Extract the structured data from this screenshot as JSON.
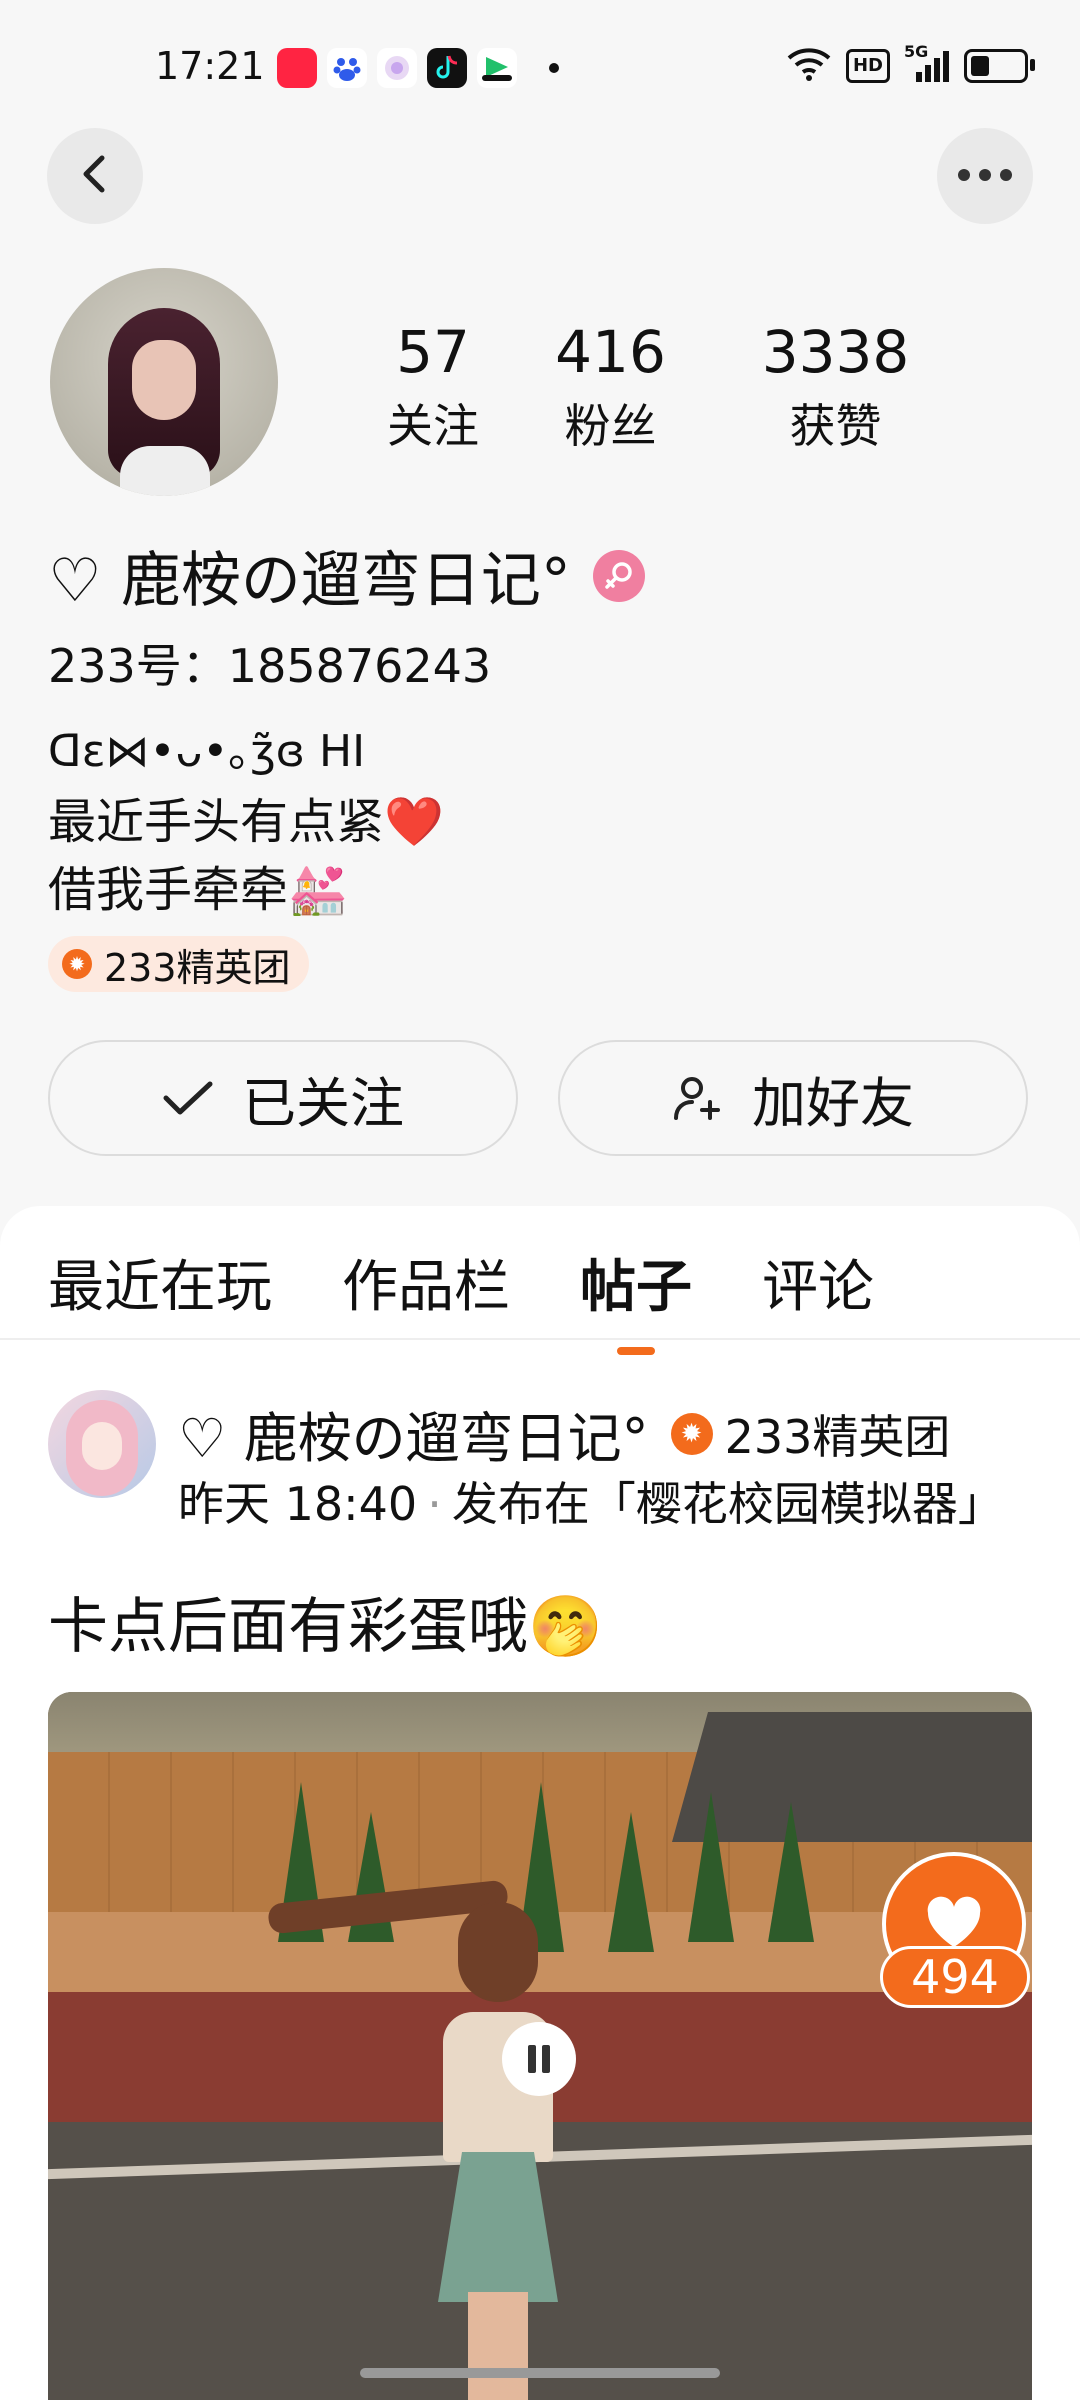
{
  "status_bar": {
    "time": "17:21",
    "app_icons": [
      "xiaohongshu-icon",
      "baidu-icon",
      "app-icon",
      "tiktok-icon",
      "video-app-icon"
    ],
    "hd_label": "HD",
    "network_label": "5G",
    "battery_level": 0.35
  },
  "profile": {
    "stats": [
      {
        "value": "57",
        "label": "关注"
      },
      {
        "value": "416",
        "label": "粉丝"
      },
      {
        "value": "3338",
        "label": "获赞"
      }
    ],
    "nickname": "♡ 鹿桉の遛弯日记°",
    "uid_text": "233号：185876243",
    "bio_line1": "ᗡɛ⋈•ᴗ•｡ʒ̃ɞ HI",
    "bio_line2": "最近手头有点紧❤️",
    "bio_line3": "借我手牵牵💒",
    "elite_tag": "233精英团"
  },
  "actions": {
    "follow_label": "已关注",
    "add_friend_label": "加好友"
  },
  "tabs": [
    {
      "label": "最近在玩",
      "active": false
    },
    {
      "label": "作品栏",
      "active": false
    },
    {
      "label": "帖子",
      "active": true
    },
    {
      "label": "评论",
      "active": false
    }
  ],
  "post": {
    "author": "♡ 鹿桉の遛弯日记°",
    "author_tag": "233精英团",
    "time": "昨天 18:40",
    "separator": "·",
    "published_in": "发布在「樱花校园模拟器」",
    "text": "卡点后面有彩蛋哦🤭",
    "like_count": "494"
  },
  "colors": {
    "accent": "#f36b1c",
    "gender_badge": "#f07fa0",
    "elite_bg": "#fde9df"
  }
}
